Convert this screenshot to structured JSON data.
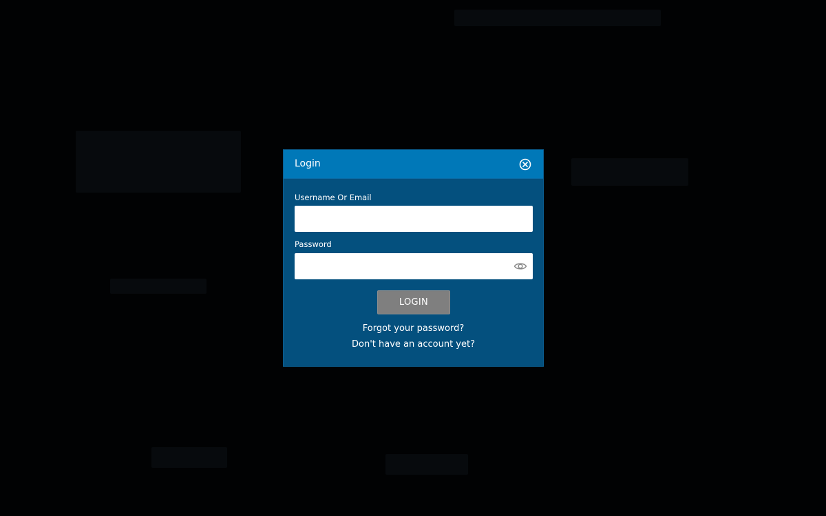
{
  "modal": {
    "title": "Login",
    "username_label": "Username Or Email",
    "username_value": "",
    "password_label": "Password",
    "password_value": "",
    "login_label": "LOGIN",
    "forgot_label": "Forgot your password?",
    "signup_label": "Don't have an account yet?"
  },
  "colors": {
    "header": "#0078b8",
    "body": "#04507e",
    "button": "#7f7f7f"
  },
  "icons": {
    "close": "close-circle-icon",
    "eye": "eye-icon"
  }
}
